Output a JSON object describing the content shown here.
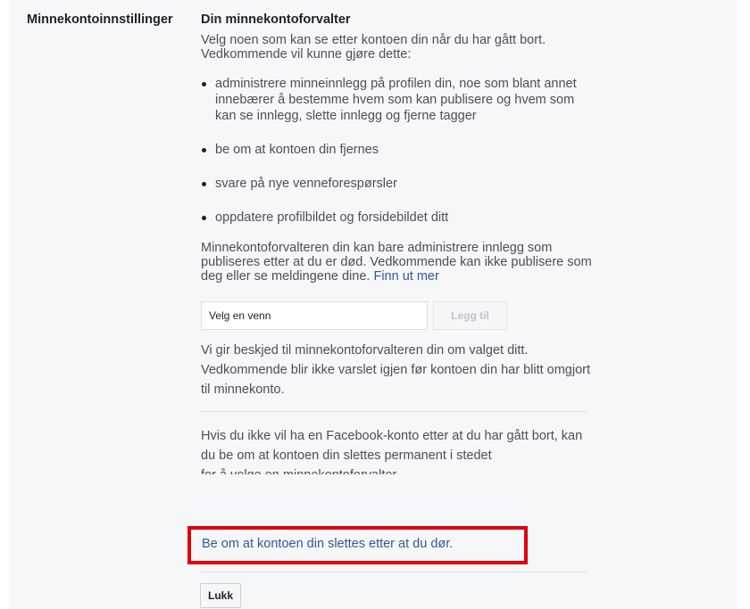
{
  "section": {
    "title": "Minnekontoinnstillinger"
  },
  "legacy": {
    "title": "Din minnekontoforvalter",
    "intro": "Velg noen som kan se etter kontoen din når du har gått bort. Vedkommende vil kunne gjøre dette:",
    "bullets": [
      "administrere minneinnlegg på profilen din, noe som blant annet innebærer å bestemme hvem som kan publisere og hvem som kan se innlegg, slette innlegg og fjerne tagger",
      "be om at kontoen din fjernes",
      "svare på nye venneforespørsler",
      "oppdatere profilbildet og forsidebildet ditt"
    ],
    "note": "Minnekontoforvalteren din kan bare administrere innlegg som publiseres etter at du er død. Vedkommende kan ikke publisere som deg eller se meldingene dine.",
    "learn_more": "Finn ut mer",
    "friend_input_placeholder": "Velg en venn",
    "add_button": "Legg til",
    "notify": "Vi gir beskjed til minnekontoforvalteren din om valget ditt. Vedkommende blir ikke varslet igjen før kontoen din har blitt omgjort til minnekonto.",
    "delete_text": "Hvis du ikke vil ha en Facebook-konto etter at du har gått bort, kan du be om at kontoen din slettes permanent i stedet",
    "delete_text_cut": "for å velge en minnekontoforvalter.",
    "delete_link": "Be om at kontoen din slettes etter at du dør.",
    "close_button": "Lukk"
  },
  "colors": {
    "highlight": "#e0000d",
    "link": "#365899"
  }
}
